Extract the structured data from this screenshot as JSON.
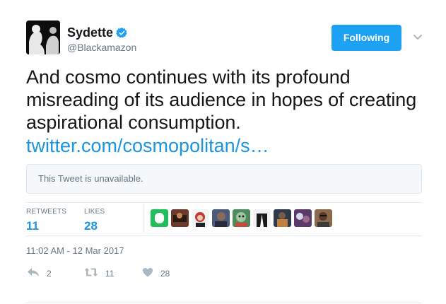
{
  "author": {
    "display_name": "Sydette",
    "handle": "@Blackamazon",
    "verified": true
  },
  "follow_button": {
    "label": "Following"
  },
  "tweet": {
    "text": "And cosmo continues with its profound misreading of its audience in hopes of creating aspirational consumption.",
    "link_text": "twitter.com/cosmopolitan/s…",
    "quoted_notice": "This Tweet is unavailable."
  },
  "stats": {
    "retweets_label": "RETWEETS",
    "retweets_count": "11",
    "likes_label": "LIKES",
    "likes_count": "28"
  },
  "likers": [
    {
      "name": "liker-1",
      "color": "#1fbf5c"
    },
    {
      "name": "liker-2",
      "color": "#6b3a2a"
    },
    {
      "name": "liker-3",
      "color": "#c23a3a"
    },
    {
      "name": "liker-4",
      "color": "#4a5a7a"
    },
    {
      "name": "liker-5",
      "color": "#4d8a5e"
    },
    {
      "name": "liker-6",
      "color": "#1a1a1a"
    },
    {
      "name": "liker-7",
      "color": "#2e3a4a"
    },
    {
      "name": "liker-8",
      "color": "#5a3a6a"
    },
    {
      "name": "liker-9",
      "color": "#8a6a4a"
    }
  ],
  "timestamp": "11:02 AM - 12 Mar 2017",
  "actions": {
    "reply_count": "2",
    "retweet_count": "11",
    "like_count": "28"
  },
  "colors": {
    "accent": "#1da1f2",
    "link": "#1b95e0",
    "muted": "#657786",
    "verified": "#1da1f2"
  },
  "icons": [
    "verified-badge-icon",
    "chevron-down-icon",
    "reply-icon",
    "retweet-icon",
    "heart-icon"
  ]
}
